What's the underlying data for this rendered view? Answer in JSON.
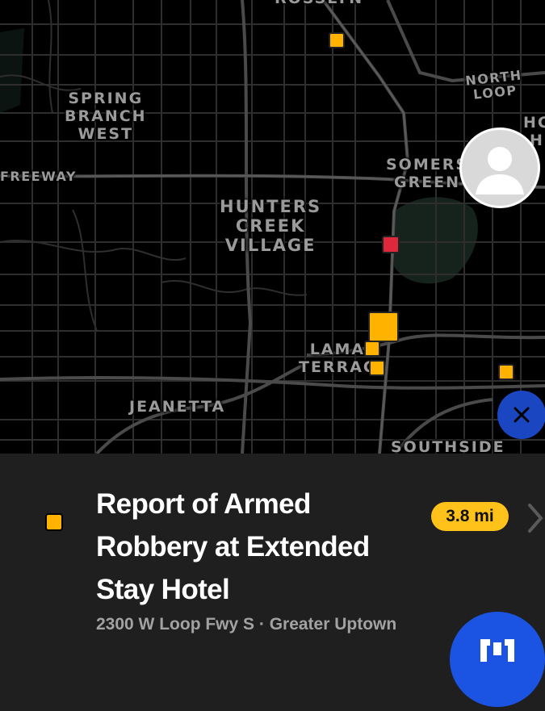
{
  "map": {
    "labels": {
      "rosslyn": "ROSSLYN",
      "north_loop": "NORTH LOOP",
      "spring_branch_west": "SPRING\nBRANCH\nWEST",
      "freeway": "FREEWAY",
      "somerset_green": "SOMERS\nGREEN",
      "hunters_creek_village": "HUNTERS\nCREEK\nVILLAGE",
      "hc_partial": "HC\nH",
      "lamar_terrace": "LAMA\nTERRAC",
      "jeanetta": "JEANETTA",
      "southside": "SOUTHSIDE"
    },
    "marker_colors": {
      "yellow": "#ffb300",
      "red": "#e0283c"
    },
    "icons": {
      "avatar": "user-avatar-icon",
      "close": "close-icon"
    }
  },
  "incident": {
    "title": "Report of Armed Robbery at Extended Stay Hotel",
    "distance": "3.8 mi",
    "address": "2300 W Loop Fwy S · Greater Uptown",
    "icon_color": "#ffb300"
  },
  "fab": {
    "icon": "app-shield-icon",
    "color": "#1b54e3"
  }
}
